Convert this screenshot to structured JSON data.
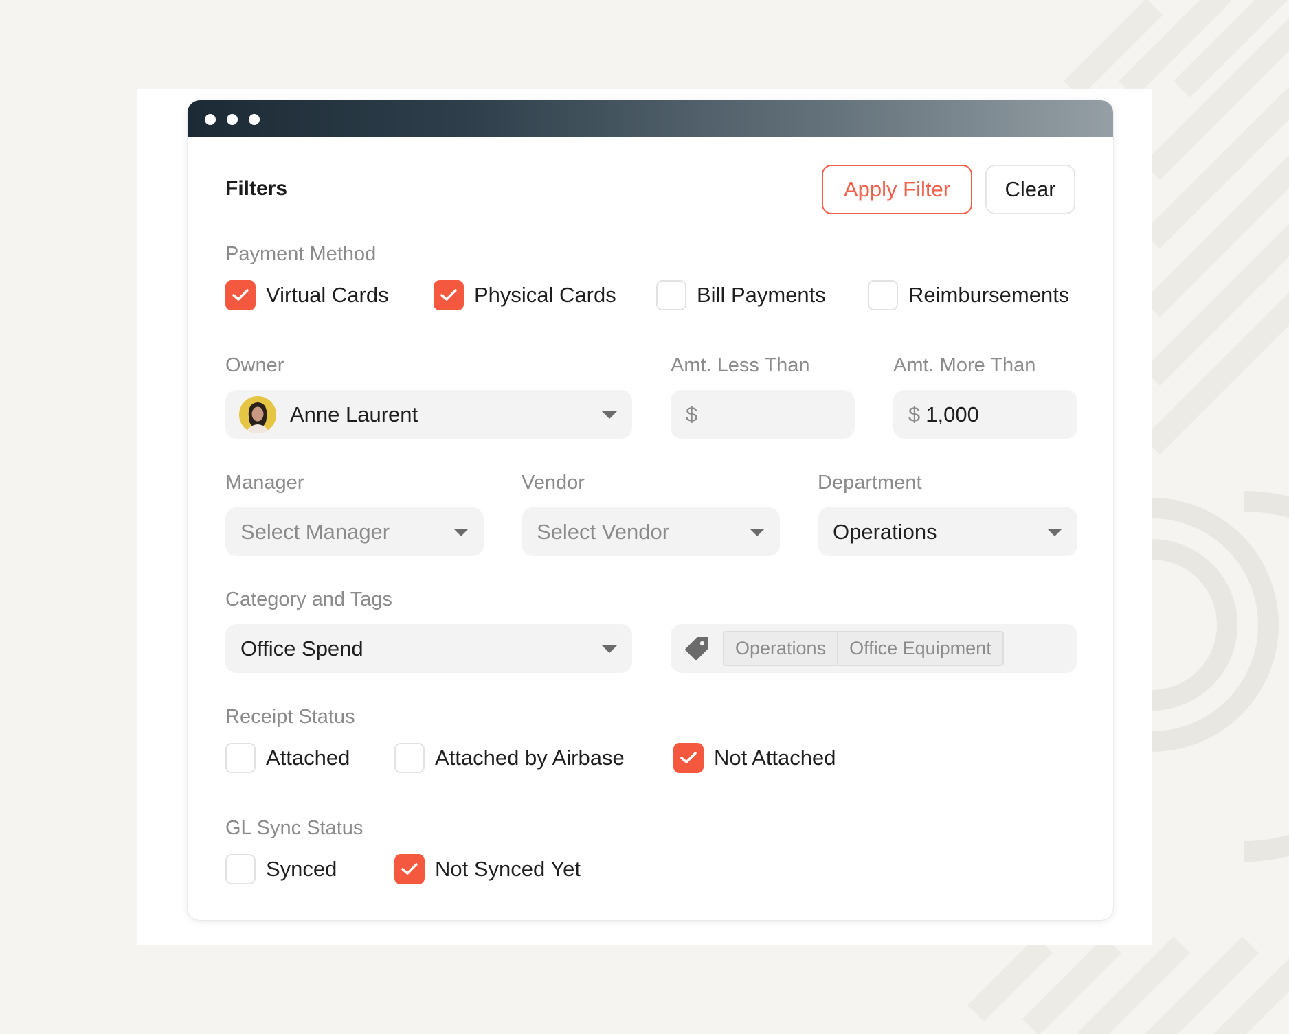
{
  "window": {
    "title": "Filters",
    "buttons": {
      "apply": "Apply Filter",
      "clear": "Clear"
    }
  },
  "payment_method": {
    "label": "Payment Method",
    "options": [
      {
        "label": "Virtual Cards",
        "checked": true
      },
      {
        "label": "Physical Cards",
        "checked": true
      },
      {
        "label": "Bill Payments",
        "checked": false
      },
      {
        "label": "Reimbursements",
        "checked": false
      }
    ]
  },
  "owner": {
    "label": "Owner",
    "value": "Anne Laurent"
  },
  "amount_less": {
    "label": "Amt. Less Than",
    "currency": "$",
    "value": ""
  },
  "amount_more": {
    "label": "Amt. More Than",
    "currency": "$",
    "value": "1,000"
  },
  "manager": {
    "label": "Manager",
    "placeholder": "Select Manager"
  },
  "vendor": {
    "label": "Vendor",
    "placeholder": "Select Vendor"
  },
  "department": {
    "label": "Department",
    "value": "Operations"
  },
  "category": {
    "label": "Category and Tags",
    "value": "Office Spend",
    "tags": [
      "Operations",
      "Office Equipment"
    ]
  },
  "receipt_status": {
    "label": "Receipt Status",
    "options": [
      {
        "label": "Attached",
        "checked": false
      },
      {
        "label": "Attached by Airbase",
        "checked": false
      },
      {
        "label": "Not Attached",
        "checked": true
      }
    ]
  },
  "gl_sync_status": {
    "label": "GL Sync Status",
    "options": [
      {
        "label": "Synced",
        "checked": false
      },
      {
        "label": "Not Synced Yet",
        "checked": true
      }
    ]
  },
  "colors": {
    "accent": "#f4593f",
    "apply_border": "#f0604a"
  },
  "icons": {
    "dropdown": "caret-down-icon",
    "tag": "tag-icon",
    "check": "checkmark-icon"
  }
}
